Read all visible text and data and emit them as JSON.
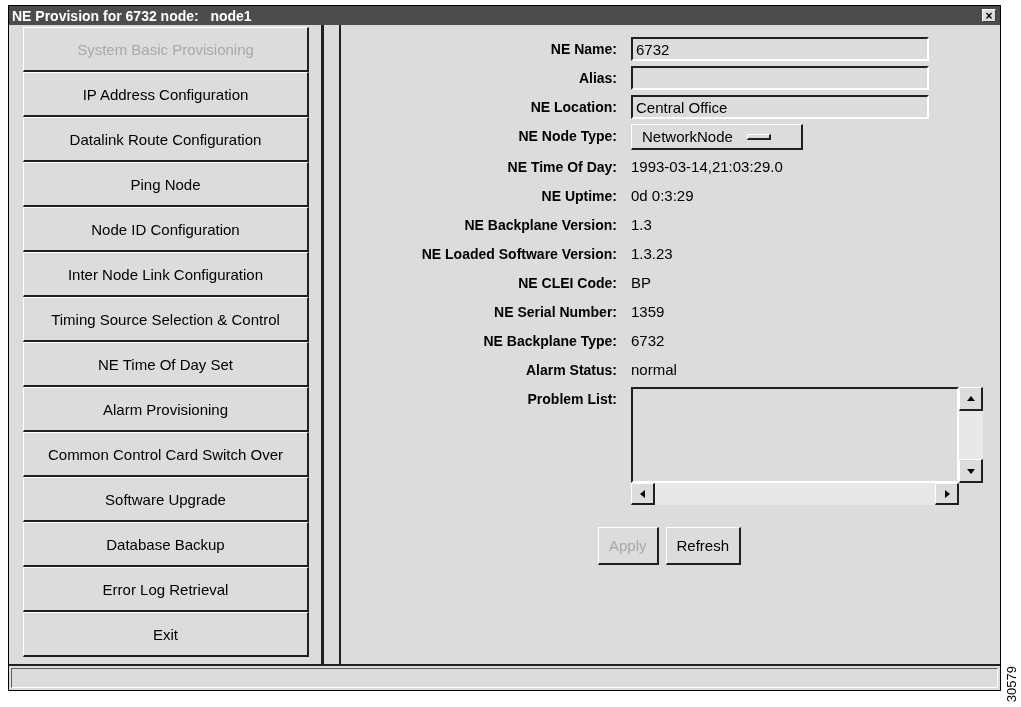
{
  "window": {
    "title": "NE Provision for 6732 node:   node1",
    "close": "×"
  },
  "sidebar": {
    "items": [
      {
        "label": "System Basic Provisioning",
        "disabled": true
      },
      {
        "label": "IP Address Configuration",
        "disabled": false
      },
      {
        "label": "Datalink Route Configuration",
        "disabled": false
      },
      {
        "label": "Ping Node",
        "disabled": false
      },
      {
        "label": "Node ID Configuration",
        "disabled": false
      },
      {
        "label": "Inter Node Link Configuration",
        "disabled": false
      },
      {
        "label": "Timing Source Selection & Control",
        "disabled": false
      },
      {
        "label": "NE Time Of Day Set",
        "disabled": false
      },
      {
        "label": "Alarm Provisioning",
        "disabled": false
      },
      {
        "label": "Common Control Card Switch Over",
        "disabled": false
      },
      {
        "label": "Software Upgrade",
        "disabled": false
      },
      {
        "label": "Database Backup",
        "disabled": false
      },
      {
        "label": "Error Log Retrieval",
        "disabled": false
      },
      {
        "label": "Exit",
        "disabled": false
      }
    ]
  },
  "form": {
    "fields": [
      {
        "label": "NE Name:",
        "kind": "text",
        "value": "6732"
      },
      {
        "label": "Alias:",
        "kind": "text"
      },
      {
        "label": "NE Location:",
        "kind": "text",
        "value": "Central Office"
      },
      {
        "label": "NE Node Type:",
        "kind": "dropdown",
        "value": "NetworkNode"
      },
      {
        "label": "NE Time Of Day:",
        "kind": "value",
        "value": "1993-03-14,21:03:29.0"
      },
      {
        "label": "NE Uptime:",
        "kind": "value",
        "value": "0d 0:3:29"
      },
      {
        "label": "NE Backplane Version:",
        "kind": "value",
        "value": "1.3"
      },
      {
        "label": "NE Loaded Software Version:",
        "kind": "value",
        "value": "1.3.23"
      },
      {
        "label": "NE CLEI Code:",
        "kind": "value",
        "value": "BP"
      },
      {
        "label": "NE Serial Number:",
        "kind": "value",
        "value": "1359"
      },
      {
        "label": "NE Backplane Type:",
        "kind": "value",
        "value": "6732"
      },
      {
        "label": "Alarm Status:",
        "kind": "value",
        "value": "normal"
      },
      {
        "label": "Problem List:",
        "kind": "list"
      }
    ],
    "buttons": [
      {
        "label": "Apply",
        "disabled": true
      },
      {
        "label": "Refresh",
        "disabled": false
      }
    ]
  },
  "figure_id": "30579"
}
